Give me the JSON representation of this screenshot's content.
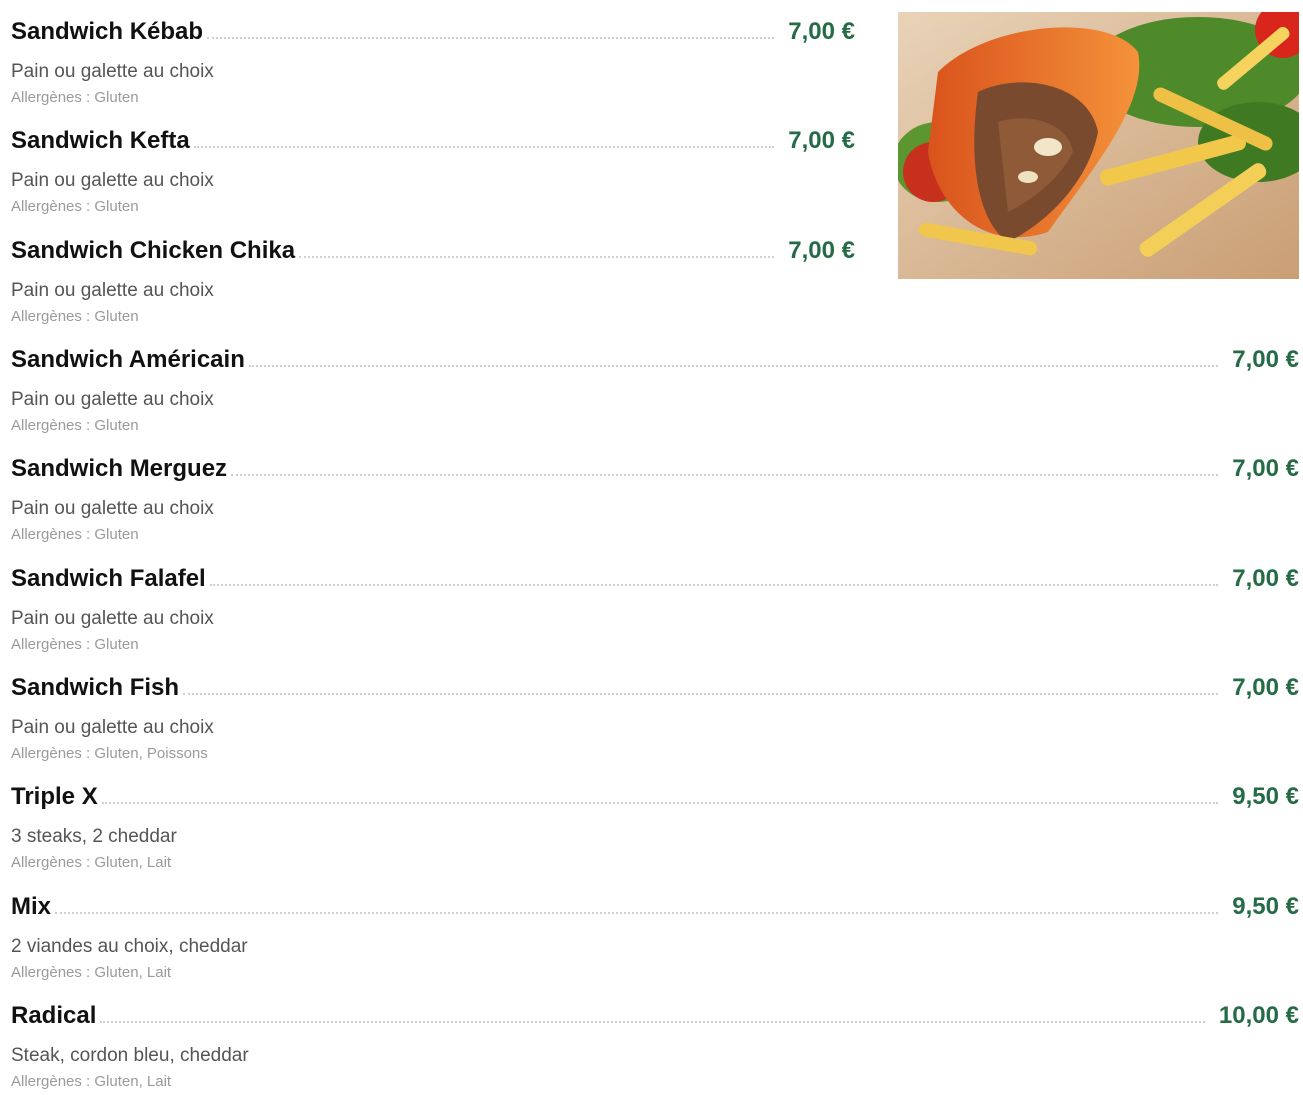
{
  "menu": {
    "items": [
      {
        "name": "Sandwich Kébab",
        "price": "7,00 €",
        "description": "Pain ou galette au choix",
        "allergens": "Allergènes : Gluten"
      },
      {
        "name": "Sandwich Kefta",
        "price": "7,00 €",
        "description": "Pain ou galette au choix",
        "allergens": "Allergènes : Gluten"
      },
      {
        "name": "Sandwich Chicken Chika",
        "price": "7,00 €",
        "description": "Pain ou galette au choix",
        "allergens": "Allergènes : Gluten"
      },
      {
        "name": "Sandwich Américain",
        "price": "7,00 €",
        "description": "Pain ou galette au choix",
        "allergens": "Allergènes : Gluten"
      },
      {
        "name": "Sandwich Merguez",
        "price": "7,00 €",
        "description": "Pain ou galette au choix",
        "allergens": "Allergènes : Gluten"
      },
      {
        "name": "Sandwich Falafel",
        "price": "7,00 €",
        "description": "Pain ou galette au choix",
        "allergens": "Allergènes : Gluten"
      },
      {
        "name": "Sandwich Fish",
        "price": "7,00 €",
        "description": "Pain ou galette au choix",
        "allergens": "Allergènes : Gluten, Poissons"
      },
      {
        "name": "Triple X",
        "price": "9,50 €",
        "description": "3 steaks, 2 cheddar",
        "allergens": "Allergènes : Gluten, Lait"
      },
      {
        "name": "Mix",
        "price": "9,50 €",
        "description": "2 viandes au choix, cheddar",
        "allergens": "Allergènes : Gluten, Lait"
      },
      {
        "name": "Radical",
        "price": "10,00 €",
        "description": "Steak, cordon bleu, cheddar",
        "allergens": "Allergènes : Gluten, Lait"
      }
    ]
  },
  "colors": {
    "price": "#256b45",
    "name": "#111111",
    "description": "#555555",
    "allergens": "#9a9a9a"
  }
}
